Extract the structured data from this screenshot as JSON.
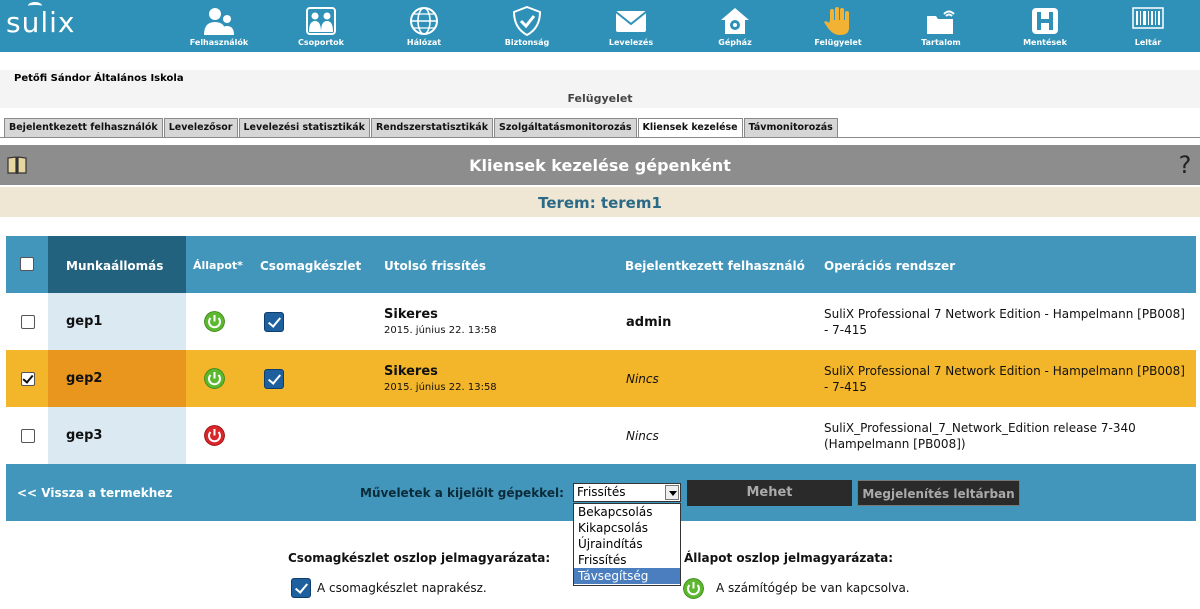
{
  "app": {
    "logo_text": "sulix"
  },
  "nav": [
    {
      "label": "Felhasználók",
      "icon": "users-icon"
    },
    {
      "label": "Csoportok",
      "icon": "groups-icon"
    },
    {
      "label": "Hálózat",
      "icon": "globe-icon"
    },
    {
      "label": "Biztonság",
      "icon": "shield-icon"
    },
    {
      "label": "Levelezés",
      "icon": "mail-icon"
    },
    {
      "label": "Gépház",
      "icon": "house-gear-icon"
    },
    {
      "label": "Felügyelet",
      "icon": "hand-icon"
    },
    {
      "label": "Tartalom",
      "icon": "folder-wifi-icon"
    },
    {
      "label": "Mentések",
      "icon": "backup-icon"
    },
    {
      "label": "Leltár",
      "icon": "barcode-icon"
    }
  ],
  "header": {
    "school_name": "Petőfi Sándor Általános Iskola",
    "section_title": "Felügyelet"
  },
  "tabs": [
    {
      "label": "Bejelentkezett felhasználók",
      "active": false
    },
    {
      "label": "Levelezősor",
      "active": false
    },
    {
      "label": "Levelezési statisztikák",
      "active": false
    },
    {
      "label": "Rendszerstatisztikák",
      "active": false
    },
    {
      "label": "Szolgáltatásmonitorozás",
      "active": false
    },
    {
      "label": "Kliensek kezelése",
      "active": true
    },
    {
      "label": "Távmonitorozás",
      "active": false
    }
  ],
  "page": {
    "title": "Kliensek kezelése gépenként",
    "help_label": "?",
    "room_label": "Terem: terem1"
  },
  "table": {
    "columns": [
      "Munkaállomás",
      "Állapot*",
      "Csomagkészlet",
      "Utolsó frissítés",
      "Bejelentkezett felhasználó",
      "Operációs rendszer"
    ],
    "rows": [
      {
        "name": "gep1",
        "selected": false,
        "power": "on",
        "pkg_ok": true,
        "update_status": "Sikeres",
        "update_date": "2015. június 22. 13:58",
        "user": "admin",
        "user_italic": false,
        "os_line1": "SuliX Professional 7 Network Edition - Hampelmann [PB008]",
        "os_line2": "- 7-415"
      },
      {
        "name": "gep2",
        "selected": true,
        "power": "on",
        "pkg_ok": true,
        "update_status": "Sikeres",
        "update_date": "2015. június 22. 13:58",
        "user": "Nincs",
        "user_italic": true,
        "os_line1": "SuliX Professional 7 Network Edition - Hampelmann [PB008]",
        "os_line2": "- 7-415"
      },
      {
        "name": "gep3",
        "selected": false,
        "power": "off",
        "pkg_ok": false,
        "update_status": "",
        "update_date": "",
        "user": "Nincs",
        "user_italic": true,
        "os_line1": "SuliX_Professional_7_Network_Edition release 7-340",
        "os_line2": "(Hampelmann [PB008])"
      }
    ]
  },
  "footer": {
    "back_label": "<< Vissza a termekhez",
    "ops_label": "Műveletek a kijelölt gépekkel:",
    "ops_selected": "Frissítés",
    "ops_options": [
      "Bekapcsolás",
      "Kikapcsolás",
      "Újraindítás",
      "Frissítés",
      "Távsegítség"
    ],
    "ops_highlighted_index": 4,
    "go_label": "Mehet",
    "inventory_label": "Megjelenítés leltárban"
  },
  "legend": {
    "pkg_title": "Csomagkészlet oszlop jelmagyarázata:",
    "pkg_text": "A csomagkészlet naprakész.",
    "state_title": "Állapot oszlop jelmagyarázata:",
    "state_text": "A számítógép be van kapcsolva."
  },
  "colors": {
    "topbar": "#2f91b8",
    "table_header": "#4296bb",
    "workstation_header": "#23627e",
    "selected_row": "#f3b52a",
    "selected_ws": "#e9961e",
    "ws_column": "#dbe9f3",
    "power_on": "#5cb82e",
    "power_off": "#d8262a",
    "room_bar": "#efe7d4"
  }
}
